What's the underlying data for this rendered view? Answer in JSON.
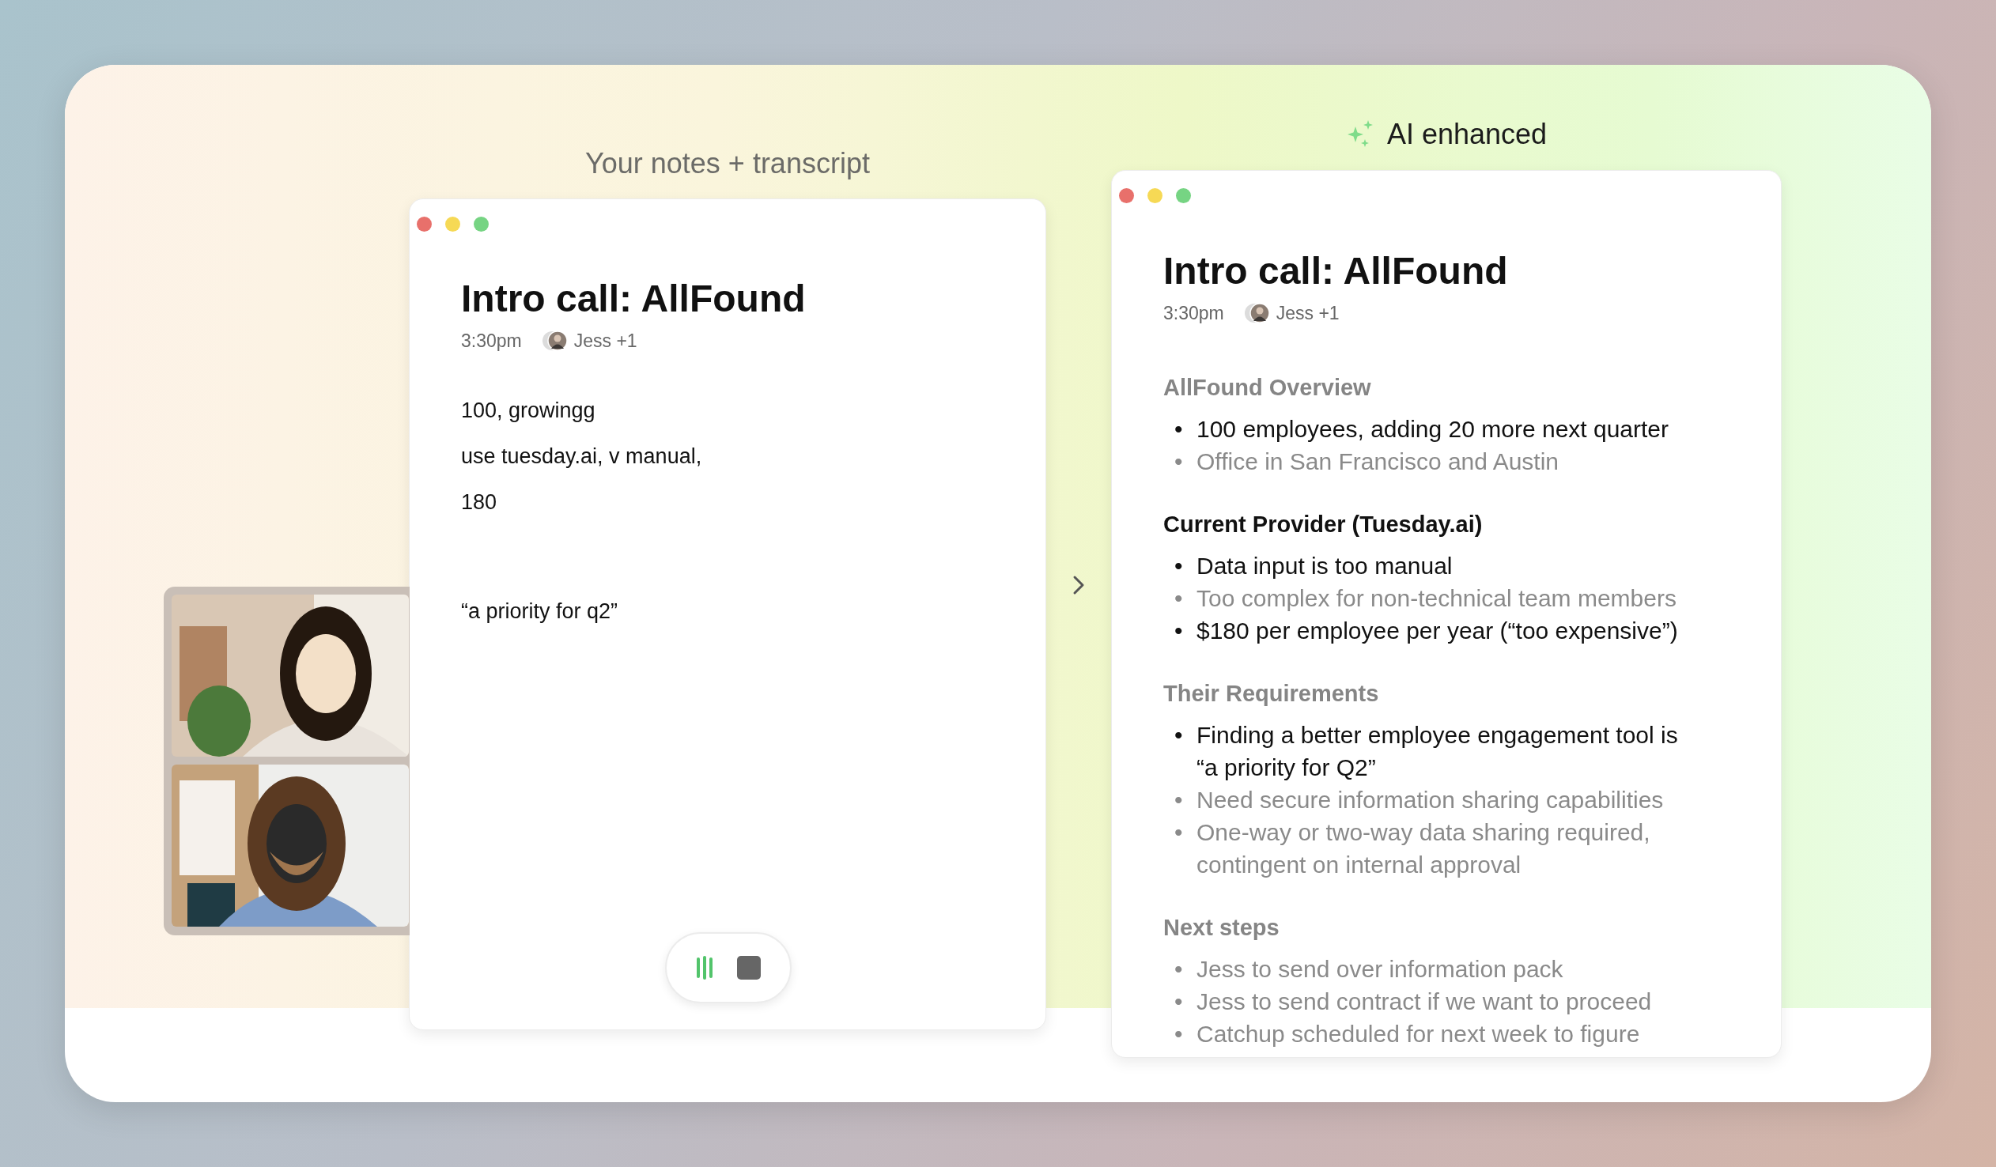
{
  "notes_panel": {
    "label": "Your notes + transcript",
    "title": "Intro call: AllFound",
    "time": "3:30pm",
    "attendees": "Jess +1",
    "note_groups": [
      {
        "lines": [
          "100, growingg",
          "use tuesday.ai, v manual,",
          "180"
        ]
      },
      {
        "lines": [
          "“a priority for q2”"
        ]
      }
    ]
  },
  "enhanced_panel": {
    "label": "AI enhanced",
    "title": "Intro call: AllFound",
    "time": "3:30pm",
    "attendees": "Jess +1",
    "sections": [
      {
        "heading": "AllFound Overview",
        "muted": true,
        "items": [
          {
            "bullet": "•",
            "text": "100 employees, adding 20 more next quarter",
            "muted": false
          },
          {
            "bullet": "•",
            "text": "Office in San Francisco and Austin",
            "muted": true
          }
        ]
      },
      {
        "heading": "Current Provider (Tuesday.ai)",
        "muted": false,
        "items": [
          {
            "bullet": "•",
            "text": "Data input is too manual",
            "muted": false
          },
          {
            "bullet": "•",
            "text": "Too complex for non-technical team members",
            "muted": true
          },
          {
            "bullet": "•",
            "text": "$180 per employee per year (“too expensive”)",
            "muted": false
          }
        ]
      },
      {
        "heading": "Their Requirements",
        "muted": true,
        "items": [
          {
            "bullet": "•",
            "text": "Finding a better employee engagement tool is “a priority for Q2”",
            "muted": false
          },
          {
            "bullet": "•",
            "text": "Need secure information sharing capabilities",
            "muted": true
          },
          {
            "bullet": "•",
            "text": "One-way or two-way data sharing required, contingent on internal approval",
            "muted": true
          }
        ]
      },
      {
        "heading": "Next steps",
        "muted": true,
        "items": [
          {
            "bullet": "•",
            "text": "Jess to send over information pack",
            "muted": true
          },
          {
            "bullet": "•",
            "text": "Jess to send contract if we want to proceed",
            "muted": true
          },
          {
            "bullet": "•",
            "text": "Catchup scheduled for next week to figure",
            "muted": true
          }
        ]
      }
    ]
  }
}
